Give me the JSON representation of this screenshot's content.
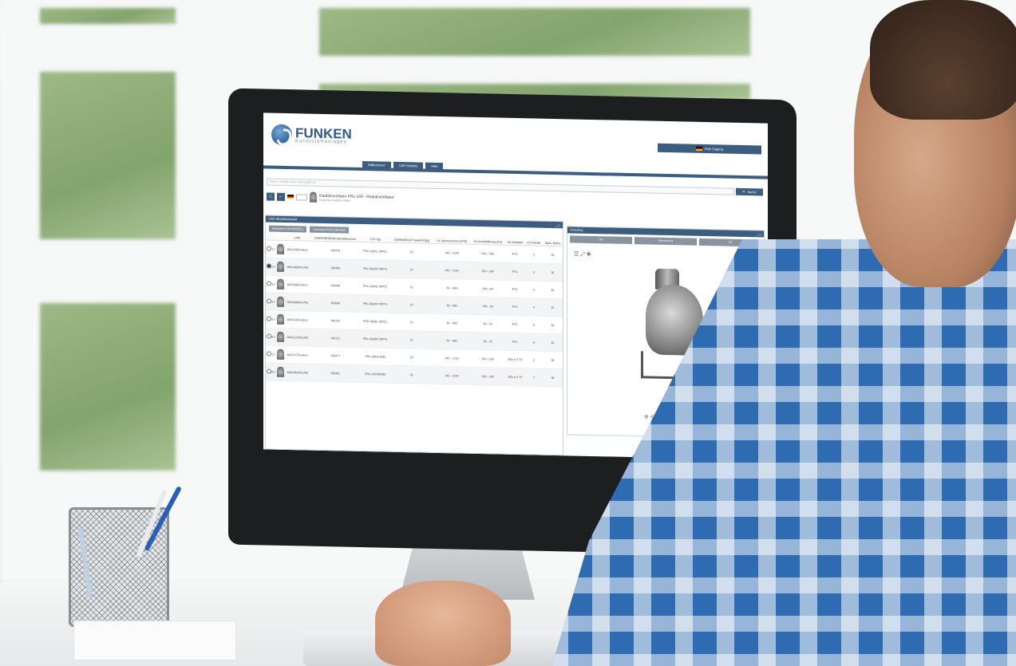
{
  "app": {
    "brand": "FUNKEN",
    "brand_sub": "Kunststoffanlagen",
    "user_label": "Kein Zugang",
    "tabs": [
      "Willkommen",
      "CAD Modelle",
      "Hilfe"
    ],
    "search_placeholder": "Geben Sie bitte einen Suchbegriff ein",
    "search_button": "Suche",
    "breadcrumb_title": "Radialventilator FRs 160 - Radialventilator",
    "breadcrumb_path": "Funken  ▸  Radialventilator"
  },
  "left_panel": {
    "title": "CAD-Modellauswahl",
    "buttons": [
      "Generiere CAD-MODELL",
      "Generiere PDF-Datenblatt"
    ],
    "columns": [
      "",
      "",
      "",
      "",
      "LINK",
      "OVERORDERNO Bestellnummer",
      "TYP Typ",
      "OVERWEIGHT Gewicht [kg]",
      "V1 Volumenstrom [m³/h]",
      "D2 Druckdifferenz [Pa]",
      "Sn Schaltart",
      "P2 Polzahl",
      "Spez. Drehz"
    ],
    "rows": [
      {
        "n": "1",
        "link": "1001478(SoAro)",
        "order": "100478",
        "type": "FRs 160/2L /DPTC",
        "weight": "15",
        "flow": "140 - 1220",
        "pressure": "920 - 200",
        "switch": "PTC",
        "poles": "2",
        "extra": "35"
      },
      {
        "n": "2",
        "link": "1001480(RecAlt)",
        "order": "100480",
        "type": "FRs 160/2R /DPTC",
        "weight": "15",
        "flow": "140 - 1220",
        "pressure": "920 - 200",
        "switch": "PTC",
        "poles": "2",
        "extra": "35"
      },
      {
        "n": "3",
        "link": "1001596(SoAro)",
        "order": "100596",
        "type": "FRs 160/4L /DPTC",
        "weight": "15",
        "flow": "30 - 590",
        "pressure": "200 - 50",
        "switch": "PTC",
        "poles": "4",
        "extra": "15"
      },
      {
        "n": "4",
        "link": "1001598(RecAlt)",
        "order": "100598",
        "type": "FRs 160/4R /DPTC",
        "weight": "15",
        "flow": "30 - 590",
        "pressure": "200 - 50",
        "switch": "PTC",
        "poles": "4",
        "extra": "15"
      },
      {
        "n": "5",
        "link": "1002120(SoAro)",
        "order": "100120",
        "type": "FRs 160/6L /DPTC",
        "weight": "15",
        "flow": "30 - 400",
        "pressure": "95 - 25",
        "switch": "PTC",
        "poles": "6",
        "extra": "10"
      },
      {
        "n": "6",
        "link": "1002121(RecAlt)",
        "order": "100121",
        "type": "FRs 160/6R /DPTC",
        "weight": "15",
        "flow": "30 - 400",
        "pressure": "95 - 25",
        "switch": "PTC",
        "poles": "6",
        "extra": "10"
      },
      {
        "n": "7",
        "link": "1001477(SoAro)",
        "order": "100477",
        "type": "FRs 160/2L/DEI",
        "weight": "20",
        "flow": "140 - 1220",
        "pressure": "920 - 200",
        "switch": "EEx e II T3",
        "poles": "2",
        "extra": "35"
      },
      {
        "n": "8",
        "link": "1001481(RecAlt)",
        "order": "100481",
        "type": "FRs 160/2R/DEI",
        "weight": "20",
        "flow": "140 - 1220",
        "pressure": "920 - 200",
        "switch": "EEx e II T3",
        "poles": "2",
        "extra": "35"
      }
    ]
  },
  "right_panel": {
    "title": "Vorschau",
    "view_buttons": [
      "3D",
      "Abmessung",
      "2D"
    ]
  },
  "colors": {
    "accent": "#3c5d80",
    "button_gray": "#8a949e",
    "shirt_blue": "#2f6bb0"
  }
}
